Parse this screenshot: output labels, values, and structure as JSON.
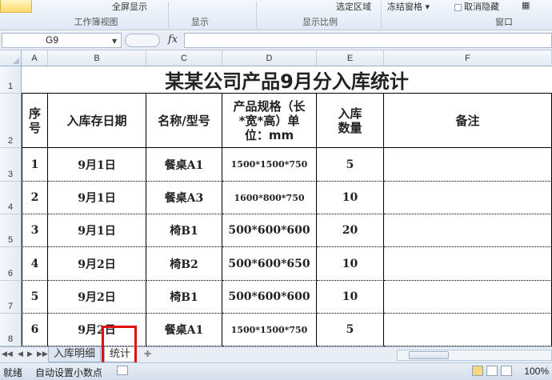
{
  "ribbon": {
    "fullscreen_label": "全屏显示",
    "zoom_to_selection_label": "选定区域",
    "freeze_panes_label": "冻结窗格",
    "unhide_label": "取消隐藏",
    "groups": [
      "工作簿视图",
      "显示",
      "显示比例",
      "窗口"
    ]
  },
  "formula_bar": {
    "name_box": "G9",
    "fx_label": "fx",
    "formula": ""
  },
  "columns": [
    "A",
    "B",
    "C",
    "D",
    "E",
    "F"
  ],
  "rows": [
    "1",
    "2",
    "3",
    "4",
    "5",
    "6",
    "7",
    "8"
  ],
  "table": {
    "title": "某某公司产品9月分入库统计",
    "headers": {
      "seq": "序号",
      "date": "入库存日期",
      "name": "名称/型号",
      "spec": "产品规格（长*宽*高）单位：mm",
      "qty": "入库数量",
      "remark": "备注"
    },
    "records": [
      {
        "seq": "1",
        "date": "9月1日",
        "name": "餐桌A1",
        "spec": "1500*1500*750",
        "qty": "5",
        "remark": ""
      },
      {
        "seq": "2",
        "date": "9月1日",
        "name": "餐桌A3",
        "spec": "1600*800*750",
        "qty": "10",
        "remark": ""
      },
      {
        "seq": "3",
        "date": "9月1日",
        "name": "椅B1",
        "spec": "500*600*600",
        "qty": "20",
        "remark": ""
      },
      {
        "seq": "4",
        "date": "9月2日",
        "name": "椅B2",
        "spec": "500*600*650",
        "qty": "10",
        "remark": ""
      },
      {
        "seq": "5",
        "date": "9月2日",
        "name": "椅B1",
        "spec": "500*600*600",
        "qty": "10",
        "remark": ""
      },
      {
        "seq": "6",
        "date": "9月2日",
        "name": "餐桌A1",
        "spec": "1500*1500*750",
        "qty": "5",
        "remark": ""
      }
    ]
  },
  "sheet_tabs": [
    "入库明细",
    "统计"
  ],
  "active_sheet": "统计",
  "status_bar": {
    "ready": "就绪",
    "auto_decimal": "自动设置小数点",
    "zoom": "100%"
  },
  "colors": {
    "highlight": "#e01010",
    "ribbon_bg": "#dfe9f5"
  }
}
